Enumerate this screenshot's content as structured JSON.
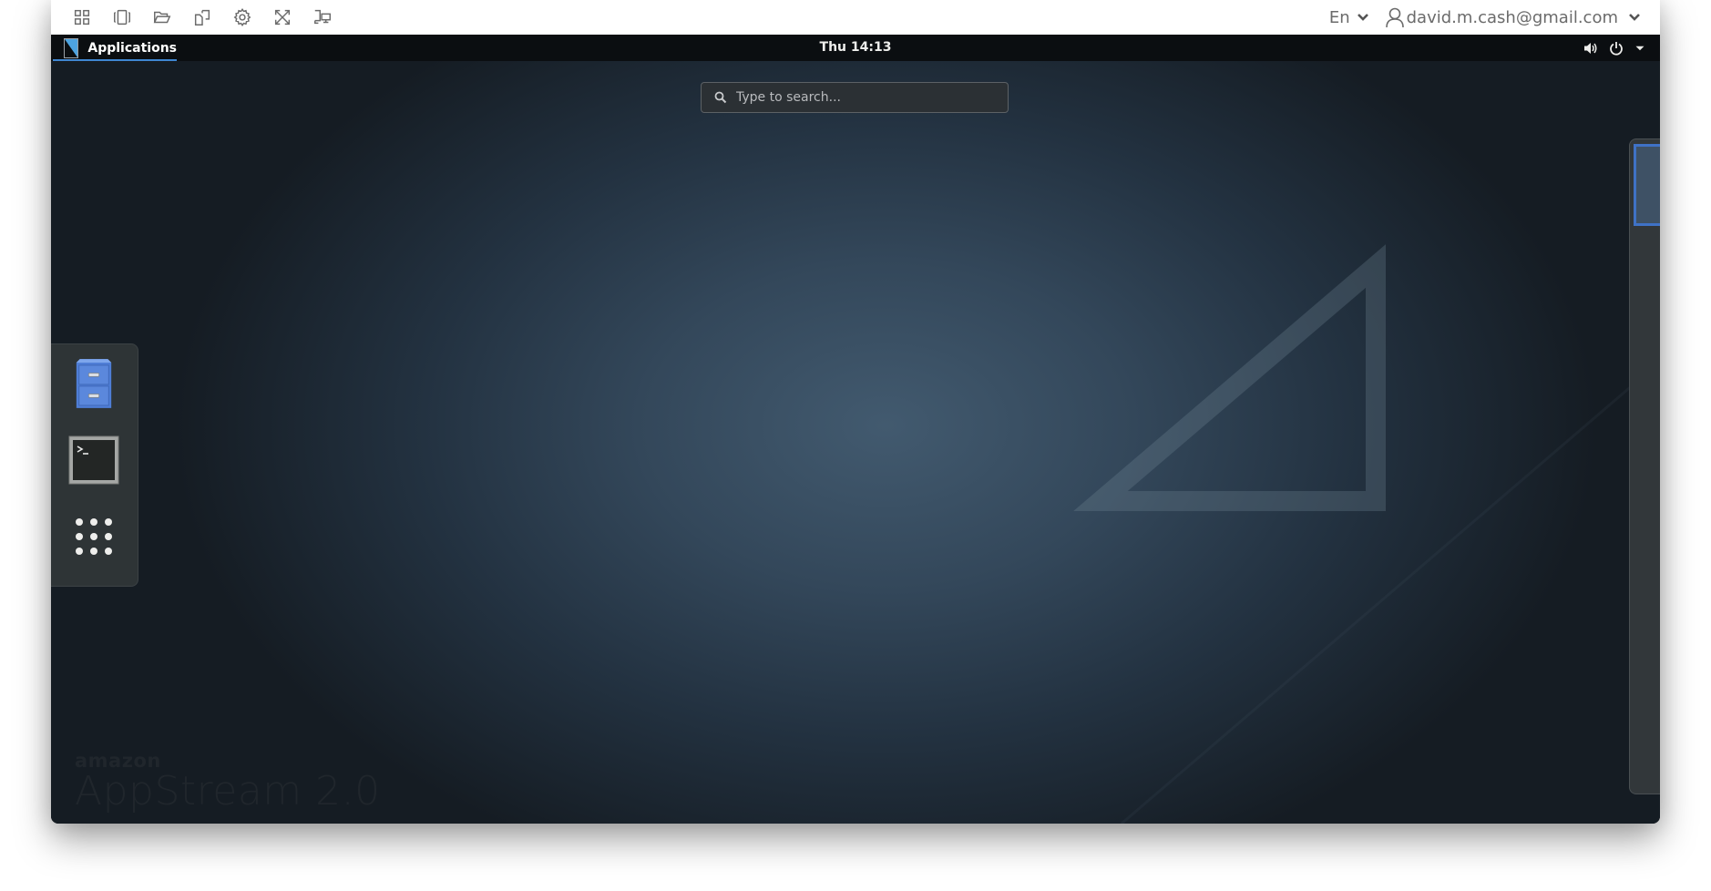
{
  "toolbar": {
    "buttons": [
      {
        "name": "catalog-button",
        "icon": "grid-icon"
      },
      {
        "name": "windows-button",
        "icon": "window-switcher-icon"
      },
      {
        "name": "my-files-button",
        "icon": "folder-open-icon"
      },
      {
        "name": "clipboard-button",
        "icon": "copy-paste-icon"
      },
      {
        "name": "settings-button",
        "icon": "gear-icon"
      },
      {
        "name": "fullscreen-button",
        "icon": "expand-arrows-icon"
      },
      {
        "name": "display-button",
        "icon": "multi-display-icon"
      }
    ],
    "language": "En",
    "user_email": "david.m.cash@gmail.com"
  },
  "panel": {
    "applications_label": "Applications",
    "clock": "Thu 14:13",
    "tray_icons": [
      "volume-icon",
      "power-icon",
      "dropdown-arrow-icon"
    ]
  },
  "overview": {
    "search_placeholder": "Type to search...",
    "dash": [
      {
        "name": "Files",
        "icon": "file-cabinet-icon"
      },
      {
        "name": "Terminal",
        "icon": "terminal-icon"
      },
      {
        "name": "Show Applications",
        "icon": "app-grid-icon"
      }
    ],
    "workspaces": 1
  },
  "branding": {
    "company": "amazon",
    "product": "AppStream 2.0"
  },
  "colors": {
    "panel_bg": "#0b0e11",
    "accent_blue": "#3f86d1",
    "search_bg": "#2b3034",
    "dash_bg": "#2e3436"
  }
}
